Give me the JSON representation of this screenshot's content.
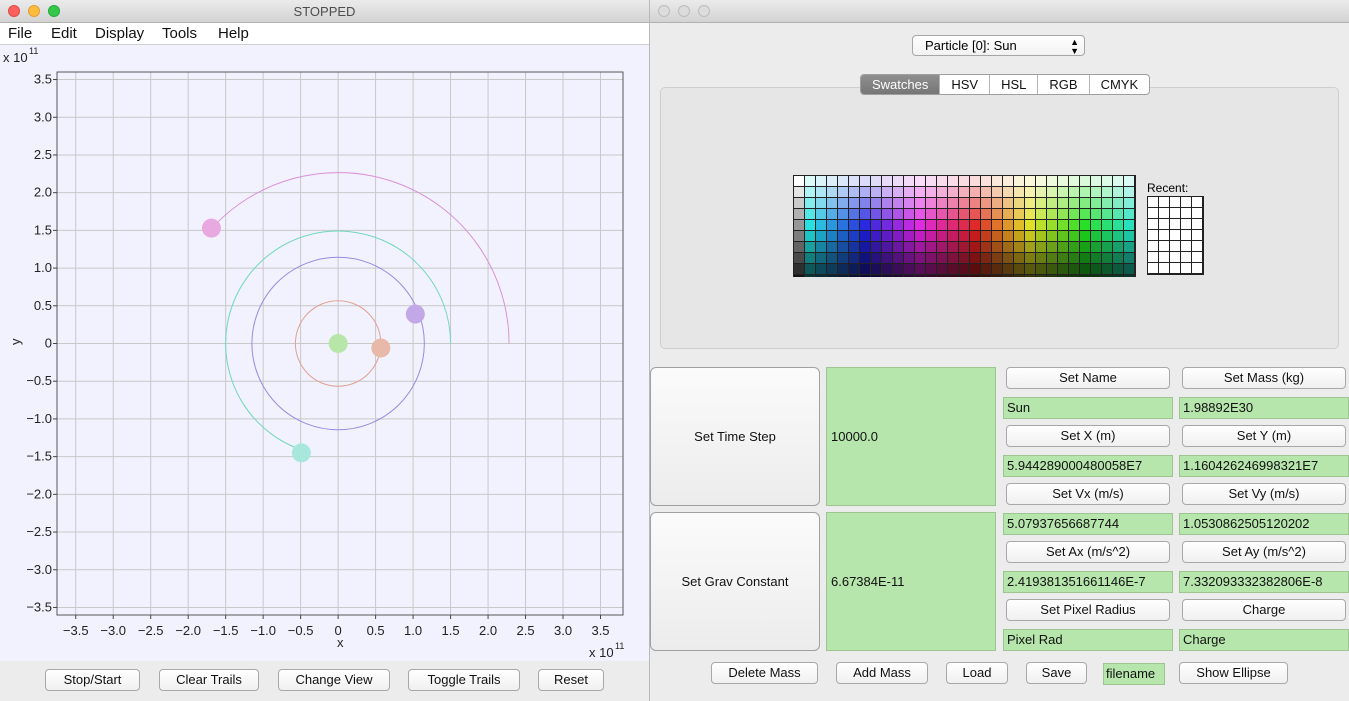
{
  "left_window": {
    "title": "STOPPED",
    "menu": [
      "File",
      "Edit",
      "Display",
      "Tools",
      "Help"
    ],
    "plot": {
      "x_multiplier": "x 10",
      "y_multiplier": "x 10",
      "exponent": "11",
      "xlabel": "x",
      "ylabel": "y",
      "x_ticks": [
        "−3.5",
        "−3.0",
        "−2.5",
        "−2.0",
        "−1.5",
        "−1.0",
        "−0.5",
        "0",
        "0.5",
        "1.0",
        "1.5",
        "2.0",
        "2.5",
        "3.0",
        "3.5"
      ],
      "y_ticks": [
        "3.5",
        "3.0",
        "2.5",
        "2.0",
        "1.5",
        "1.0",
        "0.5",
        "0",
        "−0.5",
        "−1.0",
        "−1.5",
        "−2.0",
        "−2.5",
        "−3.0",
        "−3.5"
      ]
    },
    "buttons": [
      "Stop/Start",
      "Clear Trails",
      "Change View",
      "Toggle Trails",
      "Reset"
    ]
  },
  "chart_data": {
    "type": "scatter",
    "xlabel": "x",
    "ylabel": "y",
    "xlim": [
      -3.75,
      3.8
    ],
    "ylim": [
      -3.6,
      3.6
    ],
    "grid": true,
    "bodies": [
      {
        "x": 0.0,
        "y": 0.0,
        "color": "#b8e6a8"
      },
      {
        "x": 0.57,
        "y": -0.06,
        "color": "#e8b8a8"
      },
      {
        "x": 1.03,
        "y": 0.39,
        "color": "#c3a8e8"
      },
      {
        "x": -0.49,
        "y": -1.45,
        "color": "#a8e8dc"
      },
      {
        "x": -1.69,
        "y": 1.53,
        "color": "#e8a8e0"
      }
    ],
    "orbits": [
      {
        "r": 0.57,
        "color": "#e0a090"
      },
      {
        "r": 1.15,
        "color": "#9a88e0"
      },
      {
        "r": 1.5,
        "start_deg": 0,
        "end_deg": 255,
        "color": "#70d6c0"
      },
      {
        "r": 2.28,
        "start_deg": 0,
        "end_deg": 140,
        "color": "#d890d8"
      }
    ]
  },
  "right_window": {
    "particle_select": "Particle [0]: Sun",
    "tabs": [
      "Swatches",
      "HSV",
      "HSL",
      "RGB",
      "CMYK"
    ],
    "selected_tab": "Swatches",
    "recent_label": "Recent:",
    "time_step": {
      "label": "Set Time Step",
      "value": "10000.0"
    },
    "grav_const": {
      "label": "Set Grav Constant",
      "value": "6.67384E-11"
    },
    "fields": {
      "set_name": "Set Name",
      "name": "Sun",
      "set_mass": "Set Mass (kg)",
      "mass": "1.98892E30",
      "set_x": "Set X (m)",
      "x": "5.944289000480058E7",
      "set_y": "Set Y (m)",
      "y": "1.160426246998321E7",
      "set_vx": "Set Vx (m/s)",
      "vx": "5.07937656687744",
      "set_vy": "Set Vy (m/s)",
      "vy": "1.0530862505120202",
      "set_ax": "Set Ax (m/s^2)",
      "ax": "2.419381351661146E-7",
      "set_ay": "Set Ay (m/s^2)",
      "ay": "7.332093332382806E-8",
      "set_pixel_radius": "Set Pixel Radius",
      "pixel_rad": "Pixel Rad",
      "charge_btn": "Charge",
      "charge": "Charge"
    },
    "bottom": {
      "delete_mass": "Delete Mass",
      "add_mass": "Add Mass",
      "load": "Load",
      "save": "Save",
      "filename": "filename",
      "show_ellipse": "Show Ellipse"
    }
  }
}
